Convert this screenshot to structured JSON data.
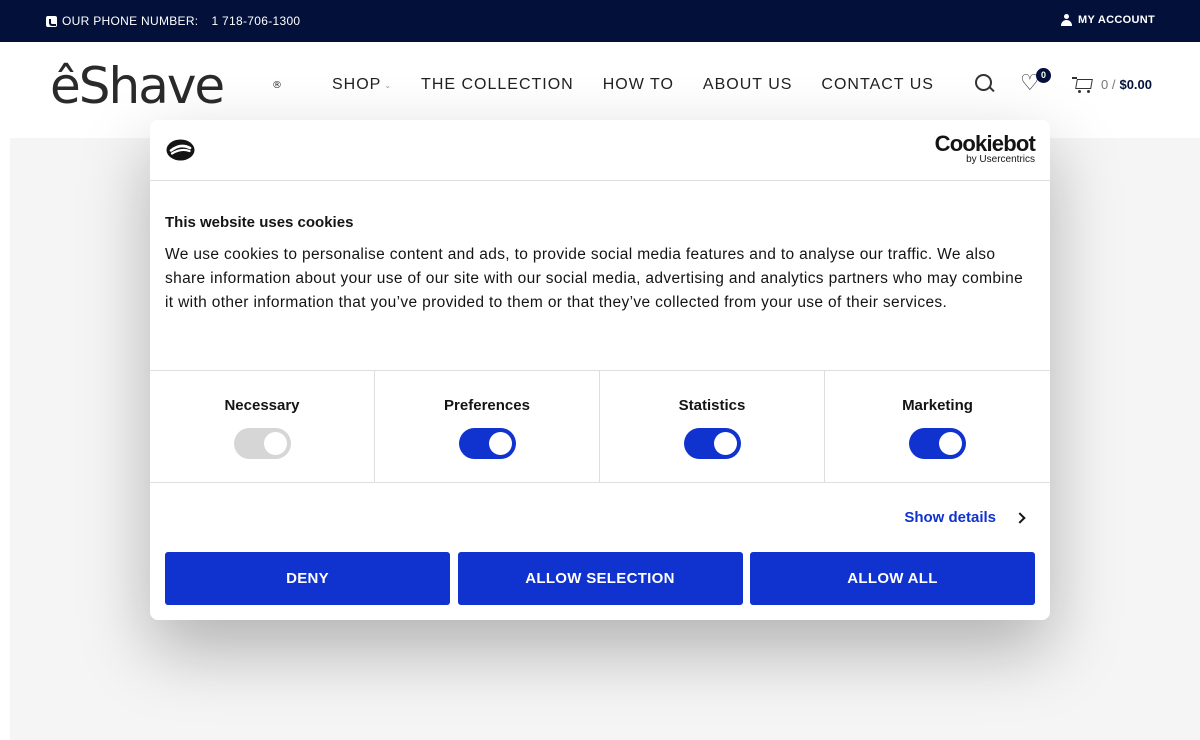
{
  "topbar": {
    "phone_label": "OUR PHONE NUMBER:",
    "phone_number": "1 718-706-1300",
    "account_label": "MY ACCOUNT"
  },
  "header": {
    "logo_text": "êShave",
    "logo_mark": "®",
    "nav": [
      {
        "label": "SHOP"
      },
      {
        "label": "THE COLLECTION"
      },
      {
        "label": "HOW TO"
      },
      {
        "label": "ABOUT US"
      },
      {
        "label": "CONTACT US"
      }
    ],
    "wishlist_count": "0",
    "cart_count": "0 /",
    "cart_total": "$0.00"
  },
  "cookie_dialog": {
    "brand_name": "Cookiebot",
    "brand_by": "by Usercentrics",
    "title": "This website uses cookies",
    "body": "We use cookies to personalise content and ads, to provide social media features and to analyse our traffic. We also share information about your use of our site with our social media, advertising and analytics partners who may combine it with other information that you’ve provided to them or that they’ve collected from your use of their services.",
    "toggles": [
      {
        "label": "Necessary",
        "enabled": true,
        "locked": true
      },
      {
        "label": "Preferences",
        "enabled": true
      },
      {
        "label": "Statistics",
        "enabled": true
      },
      {
        "label": "Marketing",
        "enabled": true
      }
    ],
    "show_details": "Show details",
    "buttons": {
      "deny": "DENY",
      "allow_selection": "ALLOW SELECTION",
      "allow_all": "ALLOW ALL"
    },
    "colors": {
      "accent": "#1032cf",
      "toggle_off": "#d6d6d6"
    }
  },
  "colors": {
    "topbar_bg": "#03103a",
    "page_bg": "#f5f5f5"
  }
}
